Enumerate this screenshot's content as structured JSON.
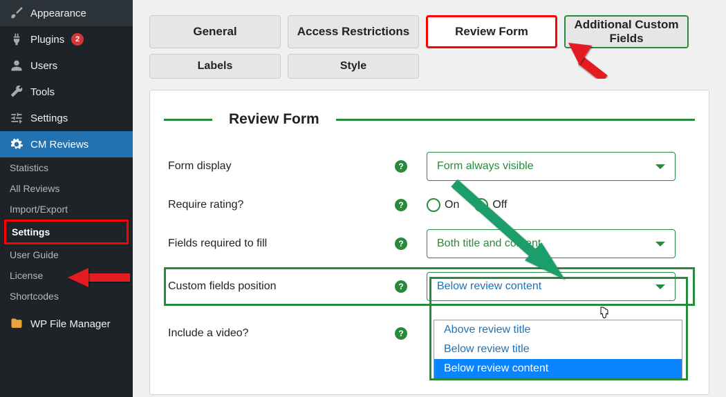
{
  "sidebar": {
    "items": [
      {
        "label": "Appearance",
        "icon": "brush-icon"
      },
      {
        "label": "Plugins",
        "icon": "plug-icon",
        "badge": "2"
      },
      {
        "label": "Users",
        "icon": "user-icon"
      },
      {
        "label": "Tools",
        "icon": "wrench-icon"
      },
      {
        "label": "Settings",
        "icon": "sliders-icon"
      },
      {
        "label": "CM Reviews",
        "icon": "gear-icon",
        "active": true
      },
      {
        "label": "WP File Manager",
        "icon": "folder-icon"
      }
    ],
    "sub_items": [
      {
        "label": "Statistics"
      },
      {
        "label": "All Reviews"
      },
      {
        "label": "Import/Export"
      },
      {
        "label": "Settings",
        "highlighted": true
      },
      {
        "label": "User Guide"
      },
      {
        "label": "License"
      },
      {
        "label": "Shortcodes"
      }
    ]
  },
  "tabs_row1": [
    {
      "label": "General"
    },
    {
      "label": "Access Restrictions"
    },
    {
      "label": "Review Form",
      "active_red": true
    },
    {
      "label": "Additional Custom Fields",
      "active_green": true
    }
  ],
  "tabs_row2": [
    {
      "label": "Labels"
    },
    {
      "label": "Style"
    }
  ],
  "section_title": "Review Form",
  "fields": {
    "form_display": {
      "label": "Form display",
      "value": "Form always visible"
    },
    "require_rating": {
      "label": "Require rating?",
      "on": "On",
      "off": "Off",
      "selected": "Off"
    },
    "fields_required": {
      "label": "Fields required to fill",
      "value": "Both title and content"
    },
    "custom_fields_position": {
      "label": "Custom fields position",
      "value": "Below review content",
      "options": [
        "Above review title",
        "Below review title",
        "Below review content"
      ],
      "selected_index": 2
    },
    "include_video": {
      "label": "Include a video?"
    }
  },
  "help_glyph": "?"
}
